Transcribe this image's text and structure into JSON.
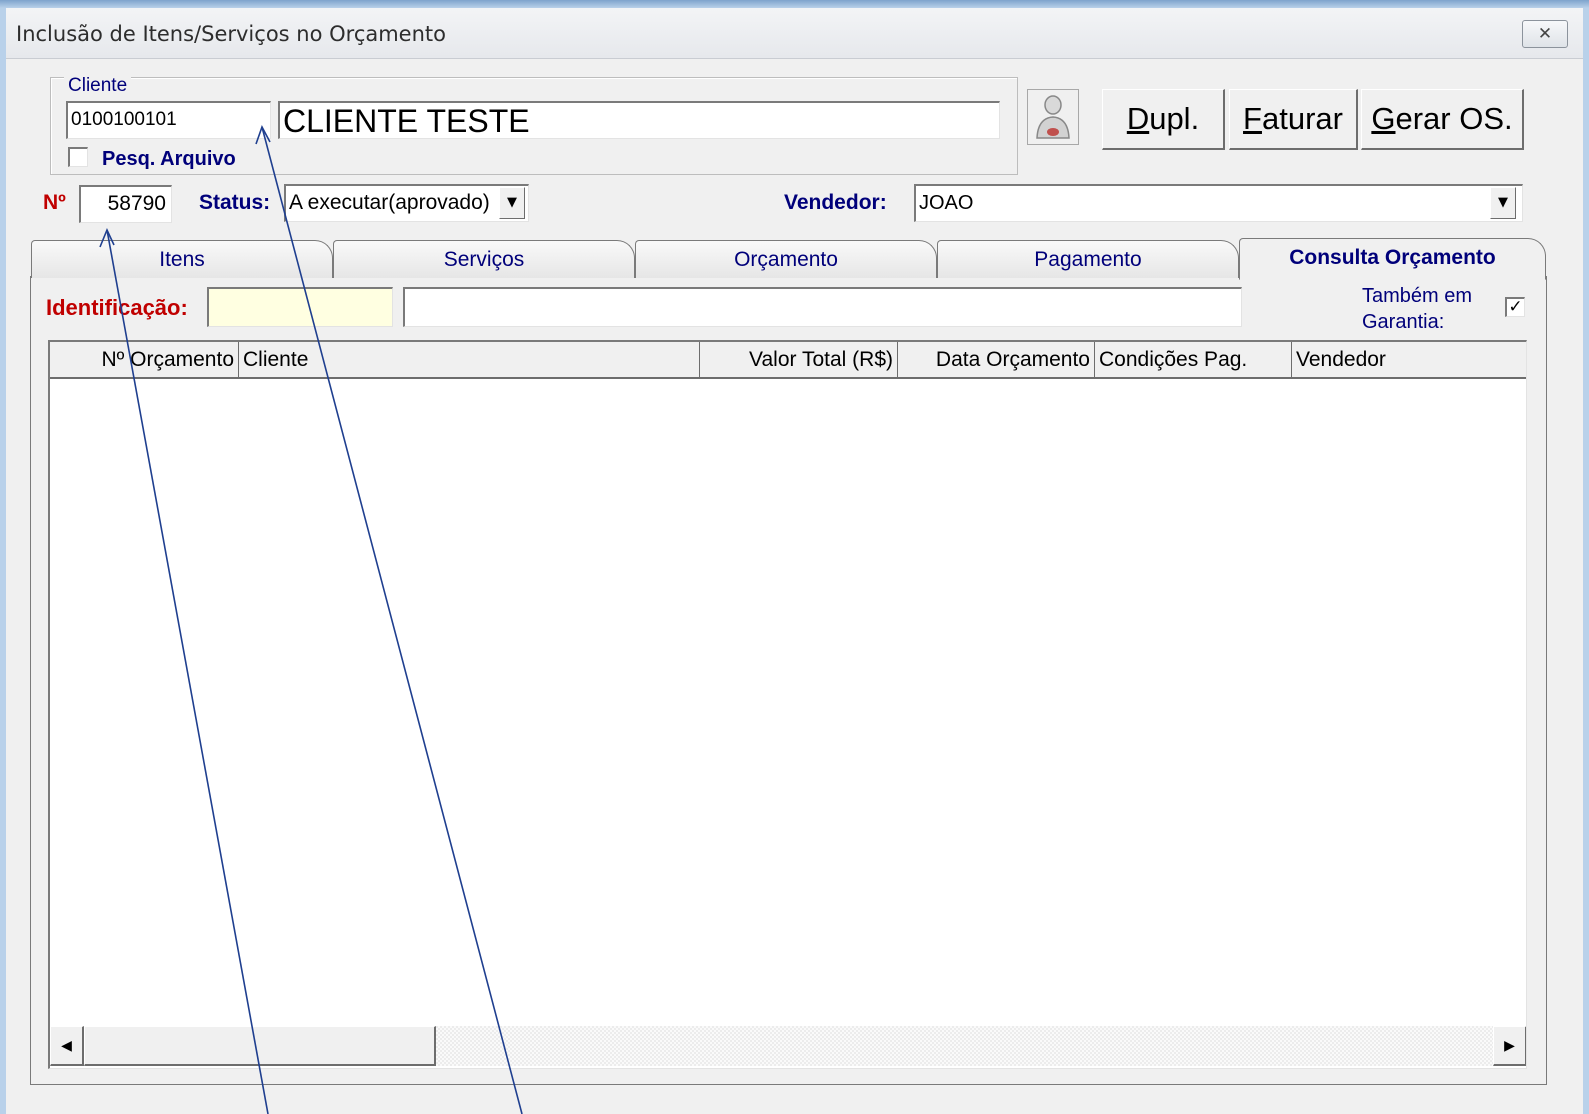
{
  "window": {
    "title": "Inclusão de Itens/Serviços no Orçamento",
    "close_glyph": "✕"
  },
  "cliente": {
    "legend": "Cliente",
    "code": "0100100101",
    "name": "CLIENTE TESTE",
    "pesq_arquivo_label": "Pesq. Arquivo",
    "pesq_arquivo_checked": false
  },
  "buttons": {
    "dupl_prefix": "D",
    "dupl_rest": "upl.",
    "faturar_prefix": "F",
    "faturar_rest": "aturar",
    "gerar_prefix": "G",
    "gerar_rest": "erar OS."
  },
  "numero": {
    "label": "Nº",
    "value": "58790"
  },
  "status": {
    "label": "Status:",
    "value": "A executar(aprovado)"
  },
  "vendedor": {
    "label": "Vendedor:",
    "value": "JOAO"
  },
  "tabs": [
    {
      "label": "Itens",
      "active": false
    },
    {
      "label": "Serviços",
      "active": false
    },
    {
      "label": "Orçamento",
      "active": false
    },
    {
      "label": "Pagamento",
      "active": false
    },
    {
      "label": "Consulta Orçamento",
      "active": true
    }
  ],
  "consulta": {
    "identificacao_label": "Identificação:",
    "identificacao_value": "",
    "search_value": "",
    "tambem_garantia_line1": "Também em",
    "tambem_garantia_line2": "Garantia:",
    "tambem_garantia_checked": true
  },
  "grid": {
    "columns": [
      "Nº Orçamento",
      "Cliente",
      "Valor Total (R$)",
      "Data Orçamento",
      "Condições Pag.",
      "Vendedor"
    ],
    "rows": []
  },
  "colors": {
    "label_blue": "#00007a",
    "label_red": "#c00000",
    "ident_bg": "#ffffe1",
    "annotation_line": "#1f3f8f"
  }
}
